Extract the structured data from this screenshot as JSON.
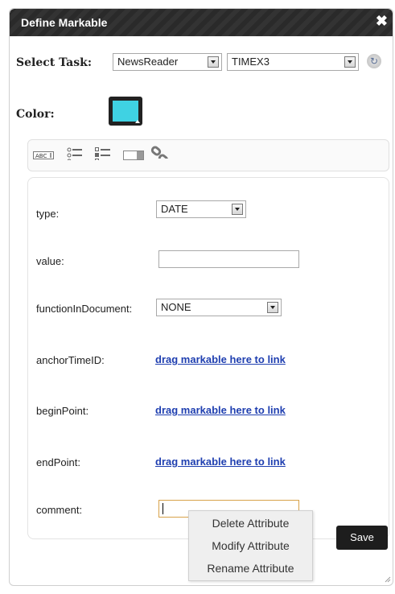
{
  "dialog": {
    "title": "Define Markable",
    "close_glyph": "✖"
  },
  "task": {
    "label": "Select Task:",
    "selected_task": "NewsReader",
    "selected_schema": "TIMEX3",
    "refresh_icon": "refresh-icon"
  },
  "color": {
    "label": "Color:",
    "value": "#3fd2e3"
  },
  "toolbar": {
    "icons": [
      "text-attribute-icon",
      "list-attribute-icon",
      "checklist-attribute-icon",
      "dropdown-attribute-icon",
      "link-attribute-icon"
    ]
  },
  "attributes": {
    "type": {
      "label": "type:",
      "value": "DATE"
    },
    "value": {
      "label": "value:",
      "value": ""
    },
    "functionInDocument": {
      "label": "functionInDocument:",
      "value": "NONE"
    },
    "anchorTimeID": {
      "label": "anchorTimeID:",
      "link": "drag markable here to link"
    },
    "beginPoint": {
      "label": "beginPoint:",
      "link": "drag markable here to link"
    },
    "endPoint": {
      "label": "endPoint:",
      "link": "drag markable here to link"
    },
    "comment": {
      "label": "comment:",
      "value": ""
    }
  },
  "context_menu": {
    "items": [
      "Delete Attribute",
      "Modify Attribute",
      "Rename Attribute"
    ]
  },
  "actions": {
    "save_label": "Save"
  }
}
